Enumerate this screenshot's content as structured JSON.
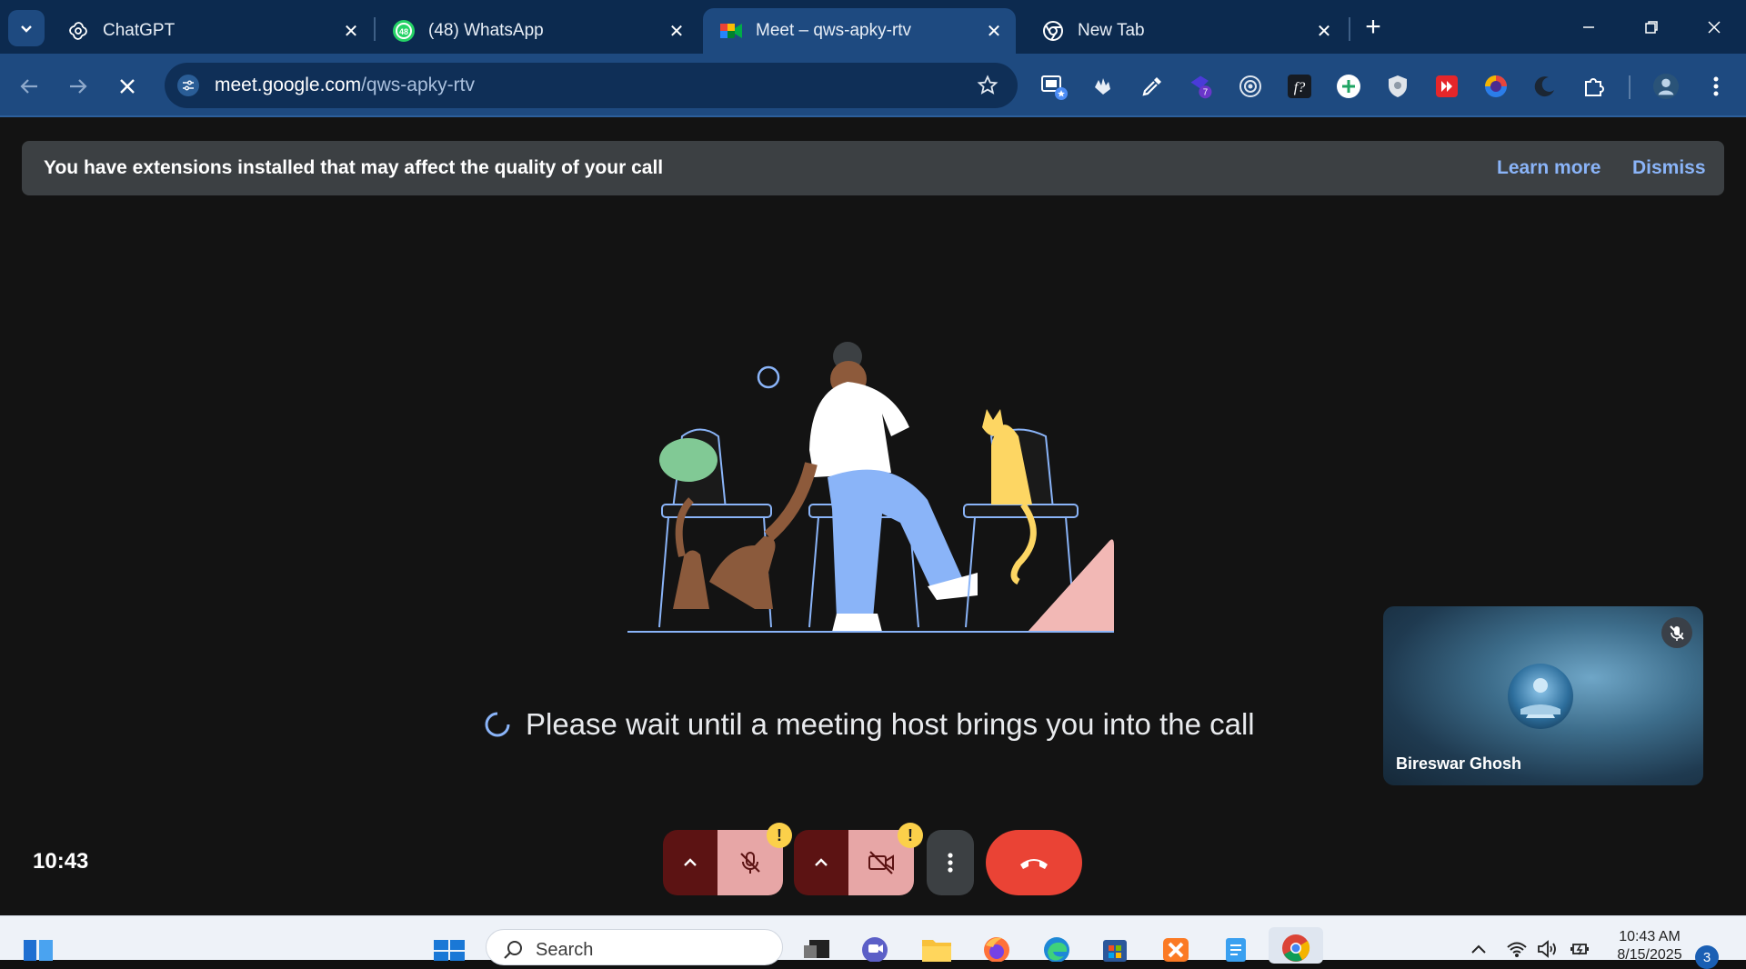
{
  "browser": {
    "tabs": [
      {
        "title": "ChatGPT",
        "icon": "chatgpt-icon",
        "active": false
      },
      {
        "title": "(48) WhatsApp",
        "icon": "whatsapp-icon",
        "active": false
      },
      {
        "title": "Meet – qws-apky-rtv",
        "icon": "google-meet-icon",
        "active": true
      },
      {
        "title": "New Tab",
        "icon": "chrome-icon",
        "active": false
      }
    ],
    "close_glyph": "✕",
    "new_tab_glyph": "+",
    "address": {
      "host": "meet.google.com",
      "path": "/qws-apky-rtv"
    },
    "extension_badge": "7"
  },
  "banner": {
    "message": "You have extensions installed that may affect the quality of your call",
    "learn_more": "Learn more",
    "dismiss": "Dismiss"
  },
  "main": {
    "waiting_text": "Please wait until a meeting host brings you into the call",
    "self_name": "Bireswar Ghosh",
    "clock": "10:43"
  },
  "controls": {
    "warning_badge": "!",
    "colors": {
      "leave": "#ea4335",
      "muted": "#e7a6a6",
      "chevron": "#5c1313",
      "warning": "#fbd04a"
    }
  },
  "taskbar": {
    "search_placeholder": "Search",
    "time": "10:43 AM",
    "date": "8/15/2025",
    "notifications": "3"
  }
}
